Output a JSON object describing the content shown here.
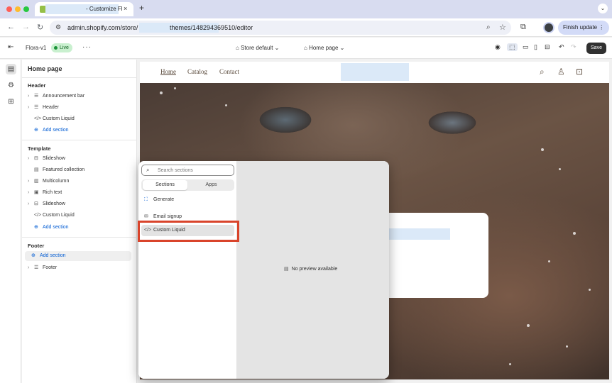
{
  "browser": {
    "tab_title": "- Customize Fl",
    "tab_close": "×",
    "new_tab": "+",
    "tab_menu": "⌄",
    "url_host": "admin.shopify.com/store/",
    "url_path": "themes/148294369510/editor",
    "finish_update": "Finish update",
    "colors": {
      "close": "#ff5f57",
      "min": "#febc2e",
      "max": "#28c840"
    }
  },
  "toolbar": {
    "theme_name": "Flora-v1",
    "live_badge": "Live",
    "more": "···",
    "store_selector": "Store default",
    "page_selector": "Home page",
    "save_label": "Save"
  },
  "sidebar": {
    "title": "Home page",
    "groups": {
      "header": {
        "label": "Header",
        "items": [
          "Announcement bar",
          "Header",
          "Custom Liquid",
          "Add section"
        ]
      },
      "template": {
        "label": "Template",
        "items": [
          "Slideshow",
          "Featured collection",
          "Multicolumn",
          "Rich text",
          "Slideshow",
          "Custom Liquid",
          "Add section"
        ]
      },
      "footer": {
        "label": "Footer",
        "items": [
          "Add section",
          "Footer"
        ]
      }
    }
  },
  "preview": {
    "nav": [
      "Home",
      "Catalog",
      "Contact"
    ]
  },
  "popover": {
    "search_placeholder": "Search sections",
    "tabs": [
      "Sections",
      "Apps"
    ],
    "items": [
      "Generate",
      "Email signup",
      "Custom Liquid"
    ],
    "no_preview": "No preview available",
    "highlight_color": "#d9442b"
  }
}
